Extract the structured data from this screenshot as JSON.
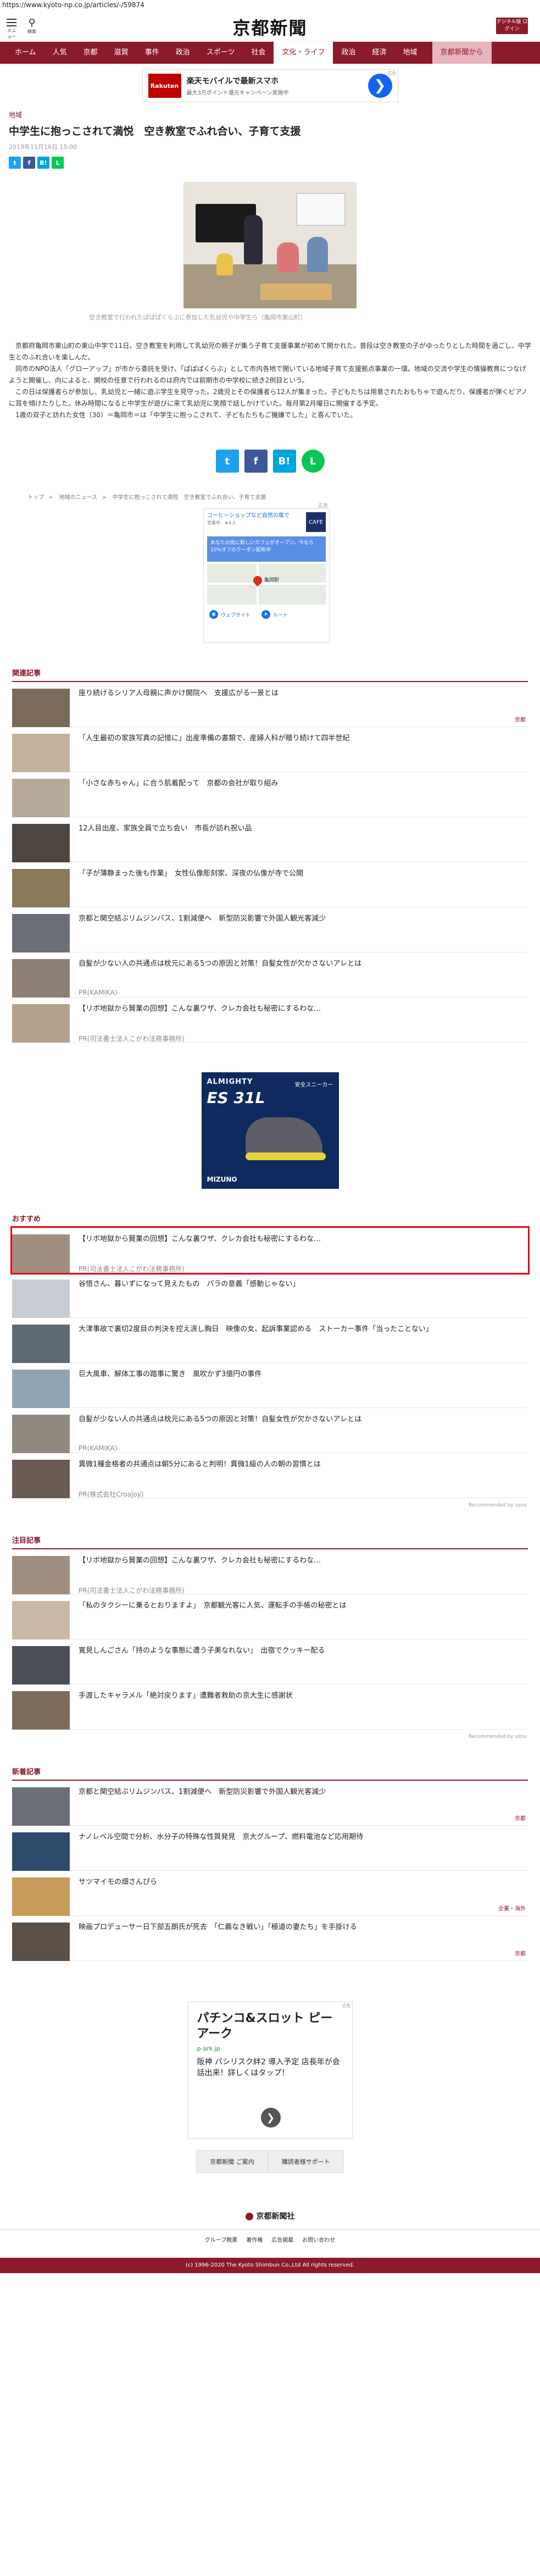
{
  "url": "https://www.kyoto-np.co.jp/articles/-/59874",
  "header": {
    "menu_label": "メニュー",
    "search_label": "検索",
    "logo": "京都新聞",
    "digital_label": "デジタル版 ログイン"
  },
  "gnav": [
    "ホーム",
    "人気",
    "京都",
    "滋賀",
    "事件",
    "政治",
    "スポーツ",
    "社会",
    "文化・ライフ",
    "政治",
    "経済",
    "地域",
    "京都新聞から"
  ],
  "gnav_active_index": 8,
  "top_ad": {
    "brand": "Rakuten",
    "title": "楽天モバイルで最新スマホ",
    "sub": "最大3万ポイント還元キャンペーン実施中",
    "tag": "広告"
  },
  "article": {
    "section": "地域",
    "title": "中学生に抱っこされて満悦　空き教室でふれ合い、子育て支援",
    "date": "2019年11月16日 15:00",
    "caption": "空き教室で行われたぱぱぱくらぶに参加した乳幼児や中学生ら（亀岡市東山町）",
    "paragraphs": [
      "京都府亀岡市東山町の東山中学で11日、空き教室を利用して乳幼児の親子が集う子育て支援事業が初めて開かれた。普段は空き教室の子がゆったりとした時間を過ごし、中学生とのふれ合いを楽しんだ。",
      "同市のNPO法人「グローアップ」が市から委託を受け、「ぱぱぱくらぶ」として市内各地で開いている地域子育て支援拠点事業の一環。地域の交流や学生の情操教育につなげようと開催し、向によると、開校の任意で行われるのは府内では前期市の中学校に続き2例目という。",
      "この日は保護者らが参加し、乳幼児と一緒に遊ぶ学生を見守った。2歳児とその保護者ら12人が集まった。子どもたちは用意されたおもちゃで遊んだり、保護者が弾くピアノに耳を傾けたりした。休み時間になると中学生が遊びに来て乳幼児に笑顔で話しかけていた。毎月第2月曜日に開催する予定。",
      "1歳の双子と訪れた女性（30）＝亀岡市＝は「中学生に抱っこされて、子どもたちもご機嫌でした」と喜んでいた。"
    ]
  },
  "share_labels": [
    "t",
    "f",
    "B!",
    "L"
  ],
  "breadcrumb": [
    "トップ",
    "地域のニュース",
    "中学生に抱っこされて満悦　空き教室でふれ合い、子育て支援"
  ],
  "map_ad": {
    "tag": "広告",
    "title": "コーヒーショップなど自然の風で",
    "sub": "営業中 · ★4.2",
    "logo": "CAFE",
    "blue_text": "あなたの街に新しいカフェがオープン。今なら10%オフのクーポン配布中",
    "map_label": "亀岡駅",
    "btn_web": "ウェブサイト",
    "btn_route": "ルート"
  },
  "related": {
    "heading": "関連記事",
    "items": [
      {
        "title": "座り続けるシリア人母親に声かけ開院へ　支援広がる一景とは",
        "tag": "京都",
        "thumb": "#7a6a5a"
      },
      {
        "title": "「人生最初の家族写真の記憶に」出産準備の書類で、産婦人科が贈り続けて四半世紀",
        "tag": "",
        "thumb": "#c4b29a"
      },
      {
        "title": "「小さな赤ちゃん」に合う肌着配って　京都の会社が取り組み",
        "tag": "",
        "thumb": "#b7a99a"
      },
      {
        "title": "12人目出産、家族全員で立ち会い　市長が訪れ祝い品",
        "tag": "",
        "thumb": "#4d4540"
      },
      {
        "title": "「子が薄静まった後も作業」　女性仏像彫刻家、深夜の仏像が寺で公開",
        "tag": "",
        "thumb": "#8a7a5a"
      },
      {
        "title": "京都と関空結ぶリムジンバス、1割減便へ　新型防災影響で外国人観光客減少",
        "tag": "",
        "thumb": "#6a6f78"
      },
      {
        "title": "自髪が少ない人の共通点は枕元にある5つの原因と対策！自髪女性が欠かさないアレとは",
        "pr": "PR(KAMIKA)",
        "thumb": "#8d7f74"
      },
      {
        "title": "【リボ地獄から賢業の回想】こんな裏ワザ、クレカ会社も秘密にするわな…",
        "pr": "PR(司法書士法人こがわ法務事務所)",
        "thumb": "#b7a08a"
      }
    ]
  },
  "mid_ad": {
    "brand": "ALMIGHTY",
    "model": "ES 31L",
    "jp_text": "安全スニーカー",
    "maker": "MIZUNO"
  },
  "recommend": {
    "heading": "おすすめ",
    "items": [
      {
        "title": "【リボ地獄から賢業の回想】こんな裏ワザ、クレカ会社も秘密にするわな…",
        "pr": "PR(司法書士法人こがわ法務事務所)",
        "thumb": "#a08f80",
        "highlight": true
      },
      {
        "title": "谷悟さん、暮いずになって見えたもの　パラの意義「感動じゃない」",
        "tag": "",
        "thumb": "#c7cdd2"
      },
      {
        "title": "大津事故で裏切2度目の判決を控え涙し胸日　映像の女、起訴事業認める　ストーカー事件「当ったことない」",
        "tag": "",
        "thumb": "#5f6a72"
      },
      {
        "title": "巨大風車、解体工事の踏事に驚き　風吹かず3億円の事件",
        "tag": "",
        "thumb": "#8fa3b3"
      },
      {
        "title": "自髪が少ない人の共通点は枕元にある5つの原因と対策！自髪女性が欠かさないアレとは",
        "pr": "PR(KAMIKA)",
        "thumb": "#90887e"
      },
      {
        "title": "異微1種金格者の共通点は朝5分にあると判明！異微1級の人の朝の習慣とは",
        "pr": "PR(株式会社Croajoy)",
        "thumb": "#6b5b54"
      }
    ],
    "credit": "Recommended by uzou"
  },
  "attention": {
    "heading": "注目記事",
    "items": [
      {
        "title": "【リボ地獄から賢業の回想】こんな裏ワザ、クレカ会社も秘密にするわな…",
        "pr": "PR(司法書士法人こがわ法務事務所)",
        "thumb": "#a08f80"
      },
      {
        "title": "「私のタクシーに乗るとおりますよ」　京都観光客に人気、運転手の手帳の秘密とは",
        "tag": "",
        "thumb": "#c8b8a3"
      },
      {
        "title": "寛見しんごさん「持のような事態に遭う子美なれない」　出宿でクッキー配る",
        "tag": "",
        "thumb": "#4b4f55"
      },
      {
        "title": "手渡したキャラメル「絶対戻ります」遭難者救助の京大生に感謝状",
        "tag": "",
        "thumb": "#7d6b5b"
      }
    ],
    "credit": "Recommended by uzou"
  },
  "latest": {
    "heading": "新着記事",
    "items": [
      {
        "title": "京都と関空結ぶリムジンバス、1割減便へ　新型防災影響で外国人観光客減少",
        "tag": "京都",
        "thumb": "#6a6f78"
      },
      {
        "title": "ナノレベル空間で分析、水分子の特殊な性質発見　京大グループ、燃料電池など応用期待",
        "tag": "",
        "thumb": "#2d4a6d"
      },
      {
        "title": "サツマイモの畑さんぴら",
        "tag": "企業・海外",
        "thumb": "#c79b58"
      },
      {
        "title": "映画プロデューサー日下部五朗氏が死去　「仁義なき戦い」「極道の妻たち」を手掛ける",
        "tag": "京都",
        "thumb": "#5b5048"
      }
    ]
  },
  "bottom_ad": {
    "tag": "広告",
    "big": "パチンコ&スロット ピーアーク",
    "small": "p-ark.jp",
    "desc": "阪神 パシリスク絆2 導入予定 店長年が会話出来！詳しくはタップ！"
  },
  "footer": {
    "buttons": [
      "京都新聞 ご案内",
      "購読者様サポート"
    ],
    "logo": "京都新聞社",
    "links": [
      "グループ概要",
      "著作権",
      "広告掲載",
      "お問い合わせ"
    ],
    "copyright": "(c) 1996-2020 The Kyoto Shimbun Co.,Ltd All rights reserved."
  },
  "colors": {
    "brand": "#8b1a2b",
    "highlight_outline": "#e60012"
  }
}
